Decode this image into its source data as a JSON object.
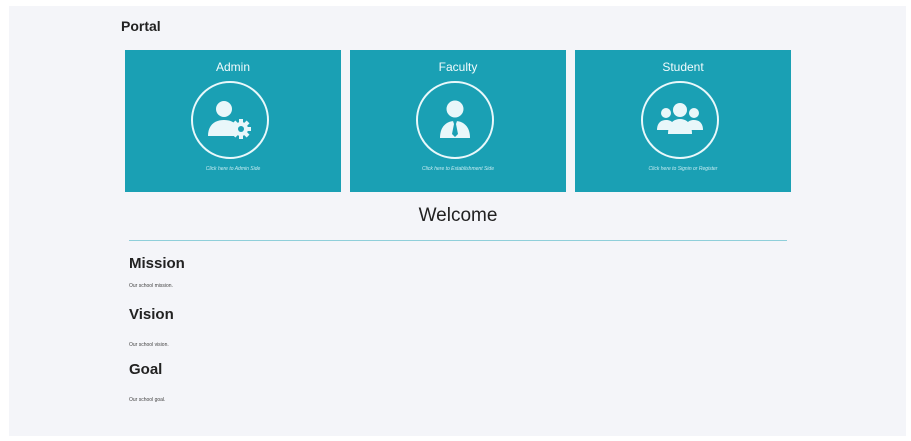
{
  "portal": {
    "title": "Portal"
  },
  "cards": [
    {
      "title": "Admin",
      "subtitle": "Click here to Admin Side",
      "icon": "admin-user-gear-icon"
    },
    {
      "title": "Faculty",
      "subtitle": "Click here to Establishment Side",
      "icon": "faculty-user-tie-icon"
    },
    {
      "title": "Student",
      "subtitle": "Click here to Signin or Register",
      "icon": "student-users-icon"
    }
  ],
  "welcome": {
    "title": "Welcome"
  },
  "sections": {
    "mission": {
      "title": "Mission",
      "text": "Our school mission."
    },
    "vision": {
      "title": "Vision",
      "text": "Our school vision."
    },
    "goal": {
      "title": "Goal",
      "text": "Our school goal."
    }
  },
  "colors": {
    "card": "#1aa0b4",
    "background": "#f4f5f9",
    "divider": "#8fcfda"
  }
}
